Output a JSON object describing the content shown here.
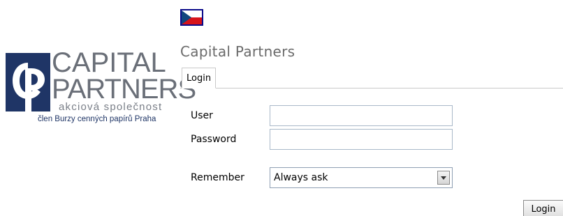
{
  "header": {
    "language_flag": "czech-flag-icon",
    "title": "Capital Partners"
  },
  "logo": {
    "line1": "CAPITAL",
    "line2": "PARTNERS",
    "line3": "akciová společnost",
    "line4": "člen Burzy cenných papírů Praha",
    "colors": {
      "mark": "#1f3566",
      "wordmark": "#6a6f78"
    }
  },
  "tabs": [
    {
      "label": "Login",
      "active": true
    }
  ],
  "form": {
    "user_label": "User",
    "user_value": "",
    "password_label": "Password",
    "password_value": "",
    "remember_label": "Remember",
    "remember_selected": "Always ask"
  },
  "actions": {
    "login_label": "Login"
  }
}
